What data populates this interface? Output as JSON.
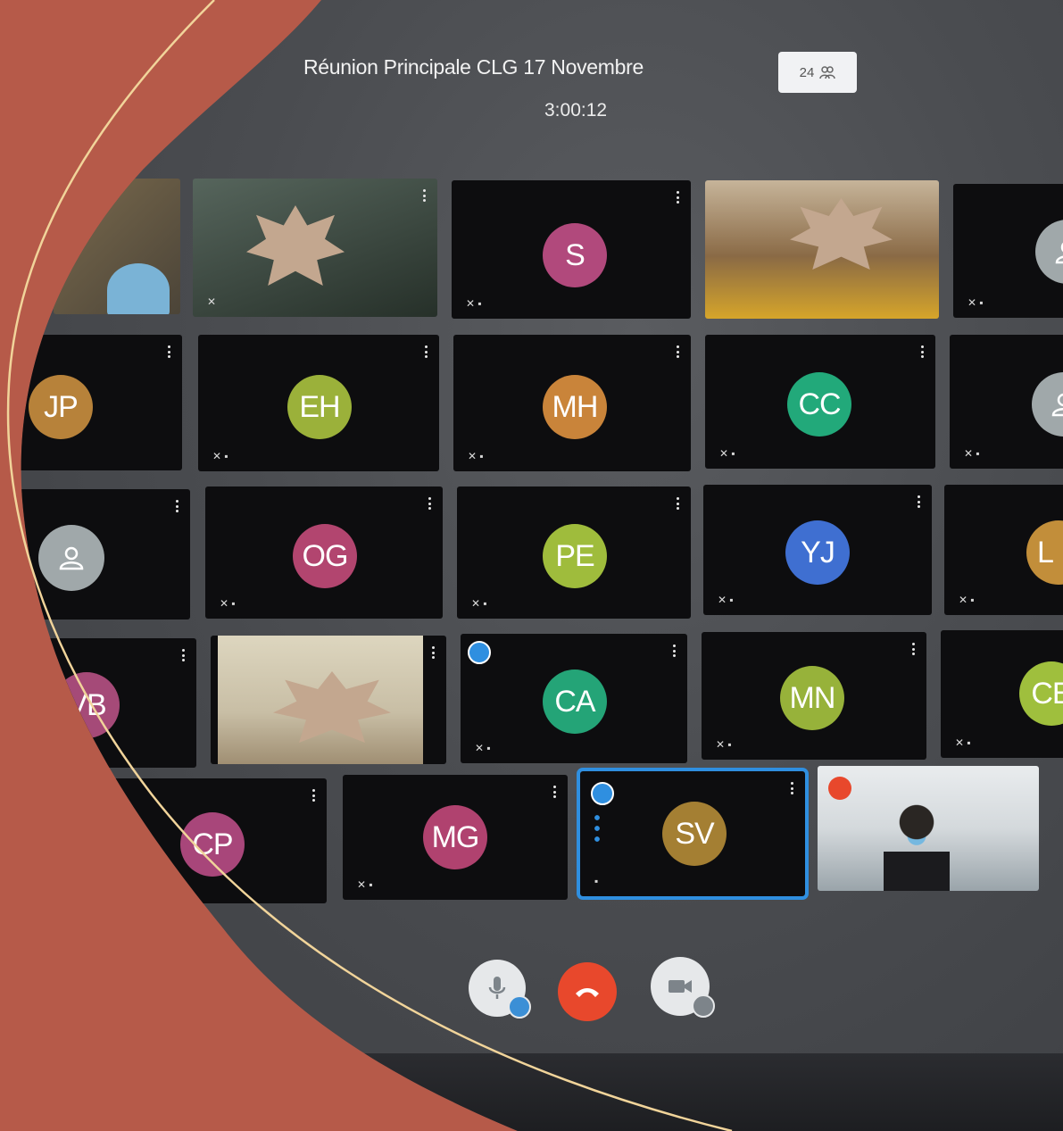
{
  "meeting": {
    "title": "Réunion Principale CLG 17 Novembre",
    "timer": "3:00:12",
    "participant_count": "24"
  },
  "tiles": [
    {
      "initials": "",
      "color": "#6b6459"
    },
    {
      "initials": "",
      "color": "#3e4a46"
    },
    {
      "initials": "S",
      "color": "#b1497c"
    },
    {
      "initials": "",
      "color": "#8c7a5c"
    },
    {
      "initials": "",
      "color": "#a0a8aa"
    },
    {
      "initials": "JP",
      "color": "#b7823a"
    },
    {
      "initials": "EH",
      "color": "#9bb13a"
    },
    {
      "initials": "MH",
      "color": "#c9843a"
    },
    {
      "initials": "CC",
      "color": "#22a97a"
    },
    {
      "initials": "",
      "color": "#a0a8aa"
    },
    {
      "initials": "",
      "color": "#a0a8aa"
    },
    {
      "initials": "OG",
      "color": "#b2456f"
    },
    {
      "initials": "PE",
      "color": "#9fbc3c"
    },
    {
      "initials": "YJ",
      "color": "#3f6fd1"
    },
    {
      "initials": "L",
      "color": "#c28e3a"
    },
    {
      "initials": "VB",
      "color": "#a54a78"
    },
    {
      "initials": "",
      "color": "#c2bda9"
    },
    {
      "initials": "CA",
      "color": "#24a477"
    },
    {
      "initials": "MN",
      "color": "#97b23a"
    },
    {
      "initials": "CE",
      "color": "#9fbf3d"
    },
    {
      "initials": "CP",
      "color": "#a8467a"
    },
    {
      "initials": "MG",
      "color": "#b0426f"
    },
    {
      "initials": "SV",
      "color": "#a47f33"
    },
    {
      "initials": "",
      "color": "#bfc6c9"
    }
  ],
  "controls": {
    "mic": "microphone-icon",
    "hangup": "hangup-icon",
    "camera": "camera-icon"
  },
  "colors": {
    "active_border": "#2f8fe0",
    "hangup_red": "#e8482c",
    "background": "#b65a49"
  }
}
